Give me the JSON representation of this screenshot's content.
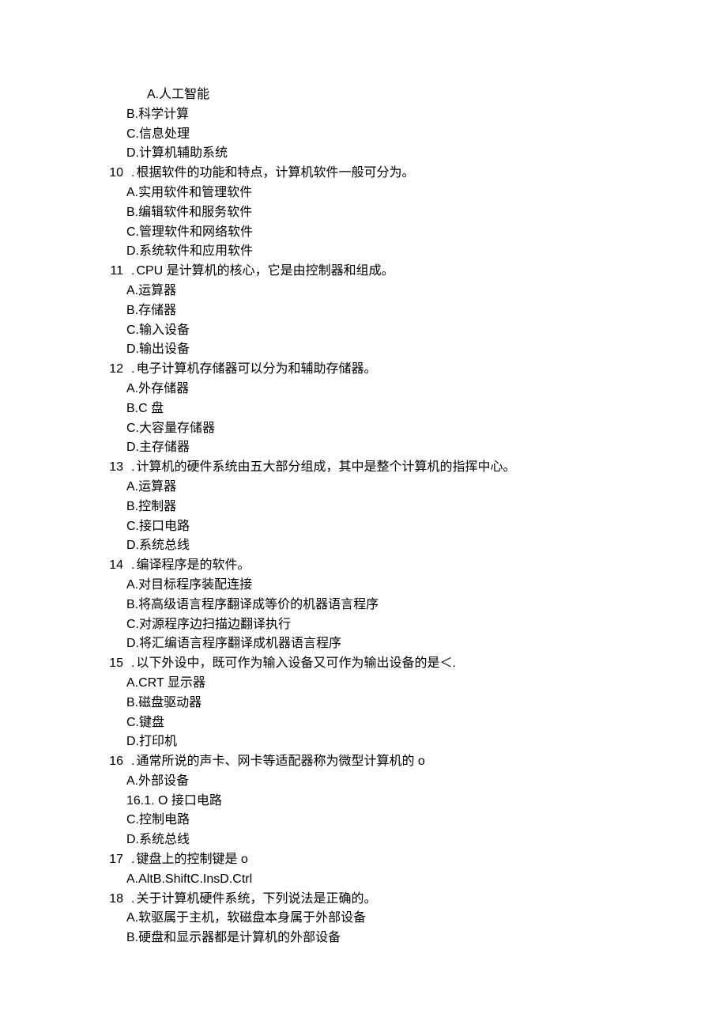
{
  "intro_options": [
    {
      "label": "A",
      "text": "人工智能",
      "indent": true
    },
    {
      "label": "B",
      "text": "科学计算",
      "indent": false
    },
    {
      "label": "C",
      "text": "信息处理",
      "indent": false
    },
    {
      "label": "D",
      "text": "计算机辅助系统",
      "indent": false
    }
  ],
  "questions": [
    {
      "num": "10",
      "text": "根据软件的功能和特点，计算机软件一般可分为。",
      "options": [
        {
          "label": "A",
          "text": "实用软件和管理软件"
        },
        {
          "label": "B",
          "text": "编辑软件和服务软件"
        },
        {
          "label": "C",
          "text": "管理软件和网络软件"
        },
        {
          "label": "D",
          "text": "系统软件和应用软件"
        }
      ]
    },
    {
      "num": "11",
      "text": "CPU 是计算机的核心，它是由控制器和组成。",
      "options": [
        {
          "label": "A",
          "text": "运算器"
        },
        {
          "label": "B",
          "text": "存储器"
        },
        {
          "label": "C",
          "text": "输入设备"
        },
        {
          "label": "D",
          "text": "输出设备"
        }
      ]
    },
    {
      "num": "12",
      "text": "电子计算机存储器可以分为和辅助存储器。",
      "options": [
        {
          "label": "A",
          "text": "外存储器"
        },
        {
          "label": "B",
          "text": "C 盘"
        },
        {
          "label": "C",
          "text": "大容量存储器"
        },
        {
          "label": "D",
          "text": "主存储器"
        }
      ]
    },
    {
      "num": "13",
      "text": " 计算机的硬件系统由五大部分组成，其中是整个计算机的指挥中心。",
      "options": [
        {
          "label": "A",
          "text": "运算器"
        },
        {
          "label": "B",
          "text": "控制器"
        },
        {
          "label": "C",
          "text": "接口电路"
        },
        {
          "label": "D",
          "text": "系统总线"
        }
      ]
    },
    {
      "num": "14",
      "text": "编译程序是的软件。",
      "options": [
        {
          "label": "A",
          "text": "对目标程序装配连接"
        },
        {
          "label": "B",
          "text": "将高级语言程序翻译成等价的机器语言程序"
        },
        {
          "label": "C",
          "text": "对源程序边扫描边翻译执行"
        },
        {
          "label": "D",
          "text": "将汇编语言程序翻译成机器语言程序"
        }
      ]
    },
    {
      "num": "15",
      "text": "以下外设中，既可作为输入设备又可作为输出设备的是＜.",
      "options": [
        {
          "label": "A",
          "text": "CRT 显示器"
        },
        {
          "label": "B",
          "text": "磁盘驱动器"
        },
        {
          "label": "C",
          "text": "键盘"
        },
        {
          "label": "D",
          "text": "打印机"
        }
      ]
    },
    {
      "num": "16",
      "text": "通常所说的声卡、网卡等适配器称为微型计算机的 o",
      "options": [
        {
          "label": "A",
          "text": "外部设备"
        },
        {
          "label": "16.1",
          "text": " O 接口电路"
        },
        {
          "label": "C",
          "text": "控制电路"
        },
        {
          "label": "D",
          "text": "系统总线"
        }
      ]
    },
    {
      "num": "17",
      "text": "键盘上的控制键是 o",
      "options": [
        {
          "label": "A",
          "text": "AltB.ShiftC.InsD.Ctrl"
        }
      ]
    },
    {
      "num": "18",
      "text": "关于计算机硬件系统，下列说法是正确的。",
      "options": [
        {
          "label": "A",
          "text": "软驱属于主机，软磁盘本身属于外部设备"
        },
        {
          "label": "B",
          "text": "硬盘和显示器都是计算机的外部设备"
        }
      ]
    }
  ]
}
